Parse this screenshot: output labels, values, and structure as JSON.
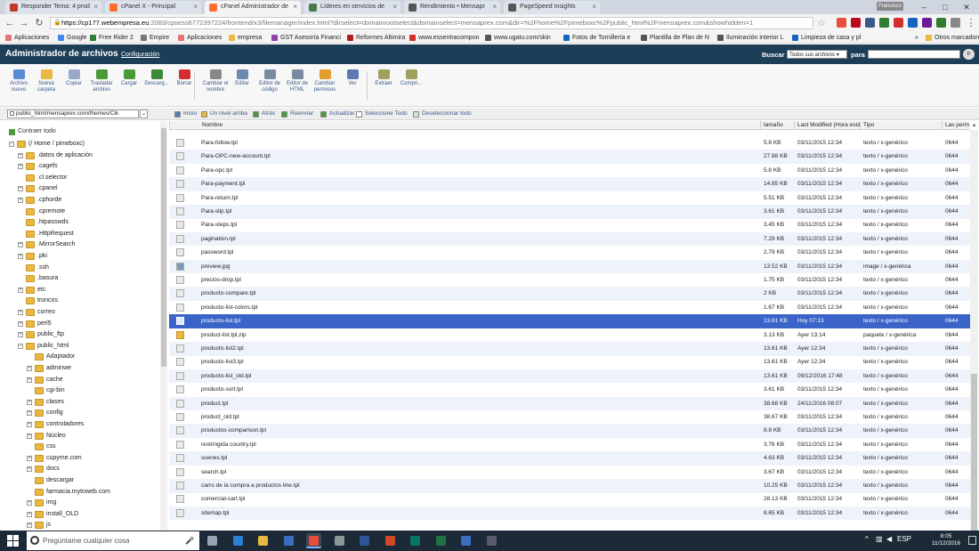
{
  "browser": {
    "tabs": [
      {
        "label": "Responder Tema: 4 prod",
        "icon": "forum-icon",
        "color": "#c0392b",
        "active": false
      },
      {
        "label": "cPanel X - Principal",
        "icon": "cpanel-icon",
        "color": "#ff6c2c",
        "active": false
      },
      {
        "label": "cPanel Administrador de",
        "icon": "cpanel-icon",
        "color": "#ff6c2c",
        "active": true
      },
      {
        "label": "Líderes en servicios de",
        "icon": "page-icon",
        "color": "#4a7a4a",
        "active": false
      },
      {
        "label": "Rendimiento • Mensapr",
        "icon": "page-icon",
        "color": "#555555",
        "active": false
      },
      {
        "label": "PageSpeed Insights",
        "icon": "page-icon",
        "color": "#555555",
        "active": false
      }
    ],
    "user": "Francisco",
    "url_host": "https://cp177.webempresa.eu",
    "url_path": ":2083/cpsess6772397224/frontend/x3/filemanager/index.html?dirselect=domainrootselect&domainselect=mensaprex.com&dir=%2Fhome%2Fpimeboxc%2Fpublic_html%2Fmensaprex.com&showhidden=1",
    "bookmarks": [
      {
        "label": "Aplicaciones",
        "color": "#e57373"
      },
      {
        "label": "Google",
        "color": "#4285f4"
      },
      {
        "label": "Free Rider 2",
        "color": "#2e7d32"
      },
      {
        "label": "Empire",
        "color": "#777777"
      },
      {
        "label": "Aplicaciones",
        "color": "#e57373"
      },
      {
        "label": "empresa",
        "color": "#e8b840"
      },
      {
        "label": "GST Asesoría Financi",
        "color": "#8e44ad"
      },
      {
        "label": "Reformes Altimira",
        "color": "#b71c1c"
      },
      {
        "label": "www.essentracompon",
        "color": "#d32f2f"
      },
      {
        "label": "www.ugatu.com/skin",
        "color": "#555555"
      },
      {
        "label": "Fotos de Tornillería e",
        "color": "#1565c0"
      },
      {
        "label": "Plantilla de Plan de N",
        "color": "#555555"
      },
      {
        "label": "Iluminación interior L",
        "color": "#555555"
      },
      {
        "label": "Limpieza de casa y pl",
        "color": "#1565c0"
      },
      {
        "label": "Otros marcadores",
        "color": "#e8b840"
      }
    ],
    "bookmarks_more": "»"
  },
  "cpanel": {
    "title": "Administrador de archivos",
    "config_link": "Configuración",
    "search_label": "Buscar",
    "search_scope": "Todos sus archivos",
    "search_for": "para",
    "search_query": "",
    "go_label": "Ir"
  },
  "toolbar": [
    {
      "label": "Archivo nuevo",
      "color": "#5a8ad0"
    },
    {
      "label": "Nueva carpeta",
      "color": "#e8b840"
    },
    {
      "label": "Copiar",
      "color": "#9aa9c8"
    },
    {
      "label": "Trasladar archivo",
      "color": "#4a9a3a"
    },
    {
      "label": "Cargar",
      "color": "#4a9a3a"
    },
    {
      "label": "Descarg...",
      "color": "#3a8a3a"
    },
    {
      "label": "Borrar",
      "color": "#d32f2f"
    },
    {
      "label": "Cambiar el nombre",
      "color": "#888888"
    },
    {
      "label": "Editar",
      "color": "#6a8ab0"
    },
    {
      "label": "Editor de código",
      "color": "#7a8aa0"
    },
    {
      "label": "Editor de HTML",
      "color": "#7a8aa0"
    },
    {
      "label": "Cambiar permisos",
      "color": "#e0a030"
    },
    {
      "label": "Ver",
      "color": "#5a7ab0"
    },
    {
      "label": "Extraer",
      "color": "#a0a060"
    },
    {
      "label": "Compri...",
      "color": "#a0a060"
    }
  ],
  "pathbar": {
    "path": "public_html/mensaprex.com/themes/Cik",
    "actions": [
      {
        "label": "Inicio",
        "color": "#5a7ab0"
      },
      {
        "label": "Un nivel arriba",
        "color": "#e8b840"
      },
      {
        "label": "Atrás",
        "color": "#4a9a3a"
      },
      {
        "label": "Reenviar",
        "color": "#4a9a3a"
      },
      {
        "label": "Actualizar",
        "color": "#4a9a3a"
      },
      {
        "label": "Seleccione Todo",
        "color": "#ffffff"
      },
      {
        "label": "Deseleccionar todo",
        "color": "#dddddd"
      }
    ]
  },
  "tree": {
    "collapse_label": "Contraer todo",
    "nodes": [
      {
        "label": "(/ Home / pimeboxc)",
        "depth": 0,
        "exp": "−"
      },
      {
        "label": ".datos de aplicación",
        "depth": 1,
        "exp": "+"
      },
      {
        "label": ".cagefs",
        "depth": 1,
        "exp": "+"
      },
      {
        "label": ".cl.selector",
        "depth": 1,
        "exp": ""
      },
      {
        "label": ".cpanel",
        "depth": 1,
        "exp": "+"
      },
      {
        "label": ".cphorde",
        "depth": 1,
        "exp": "+"
      },
      {
        "label": ".cpremote",
        "depth": 1,
        "exp": ""
      },
      {
        "label": ".htpasswds",
        "depth": 1,
        "exp": ""
      },
      {
        "label": ".HttpRequest",
        "depth": 1,
        "exp": ""
      },
      {
        "label": ".MirrorSearch",
        "depth": 1,
        "exp": "+"
      },
      {
        "label": ".pki",
        "depth": 1,
        "exp": "+"
      },
      {
        "label": ".ssh",
        "depth": 1,
        "exp": ""
      },
      {
        "label": ".basura",
        "depth": 1,
        "exp": ""
      },
      {
        "label": "etc",
        "depth": 1,
        "exp": "+"
      },
      {
        "label": "troncos",
        "depth": 1,
        "exp": ""
      },
      {
        "label": "correo",
        "depth": 1,
        "exp": "+"
      },
      {
        "label": "perl5",
        "depth": 1,
        "exp": "+"
      },
      {
        "label": "public_ftp",
        "depth": 1,
        "exp": "+"
      },
      {
        "label": "public_html",
        "depth": 1,
        "exp": "−"
      },
      {
        "label": "Adaptador",
        "depth": 2,
        "exp": ""
      },
      {
        "label": "adminwe",
        "depth": 2,
        "exp": "+"
      },
      {
        "label": "cache",
        "depth": 2,
        "exp": "+"
      },
      {
        "label": "cgi-bin",
        "depth": 2,
        "exp": ""
      },
      {
        "label": "clases",
        "depth": 2,
        "exp": "+"
      },
      {
        "label": "config",
        "depth": 2,
        "exp": "+"
      },
      {
        "label": "controladores",
        "depth": 2,
        "exp": "+"
      },
      {
        "label": "Núcleo",
        "depth": 2,
        "exp": "+"
      },
      {
        "label": "css",
        "depth": 2,
        "exp": ""
      },
      {
        "label": "cupyme.com",
        "depth": 2,
        "exp": "+"
      },
      {
        "label": "docs",
        "depth": 2,
        "exp": "+"
      },
      {
        "label": "descargar",
        "depth": 2,
        "exp": ""
      },
      {
        "label": "farmacia.mytoweb.com",
        "depth": 2,
        "exp": ""
      },
      {
        "label": "img",
        "depth": 2,
        "exp": "+"
      },
      {
        "label": "install_OLD",
        "depth": 2,
        "exp": "+"
      },
      {
        "label": "js",
        "depth": 2,
        "exp": "+"
      }
    ]
  },
  "files": {
    "columns": [
      "Nombre",
      "tamaño",
      "Last Modified (Hora está",
      "Tipo",
      "Las perm"
    ],
    "rows": [
      {
        "name": "Para-follow.tpl",
        "size": "5.8 KB",
        "modified": "03/11/2015 12:34",
        "type": "texto / x-genérico",
        "perms": "0644",
        "icon": "file"
      },
      {
        "name": "Para-OPC-new-account.tpl",
        "size": "27.88 KB",
        "modified": "03/11/2015 12:34",
        "type": "texto / x-genérico",
        "perms": "0644",
        "icon": "file"
      },
      {
        "name": "Para-opc.tpl",
        "size": "5.8 KB",
        "modified": "03/11/2015 12:34",
        "type": "texto / x-genérico",
        "perms": "0644",
        "icon": "file"
      },
      {
        "name": "Para-payment.tpl",
        "size": "14.85 KB",
        "modified": "03/11/2015 12:34",
        "type": "texto / x-genérico",
        "perms": "0644",
        "icon": "file"
      },
      {
        "name": "Para-return.tpl",
        "size": "5.51 KB",
        "modified": "03/11/2015 12:34",
        "type": "texto / x-genérico",
        "perms": "0644",
        "icon": "file"
      },
      {
        "name": "Para-slip.tpl",
        "size": "3.61 KB",
        "modified": "03/11/2015 12:34",
        "type": "texto / x-genérico",
        "perms": "0644",
        "icon": "file"
      },
      {
        "name": "Para-steps.tpl",
        "size": "3.45 KB",
        "modified": "03/11/2015 12:34",
        "type": "texto / x-genérico",
        "perms": "0644",
        "icon": "file"
      },
      {
        "name": "pagination.tpl",
        "size": "7.29 KB",
        "modified": "03/11/2015 12:34",
        "type": "texto / x-genérico",
        "perms": "0644",
        "icon": "file"
      },
      {
        "name": "password.tpl",
        "size": "2.79 KB",
        "modified": "03/11/2015 12:34",
        "type": "texto / x-genérico",
        "perms": "0644",
        "icon": "file"
      },
      {
        "name": "preview.jpg",
        "size": "13.52 KB",
        "modified": "03/11/2015 12:34",
        "type": "image / x-genérica",
        "perms": "0644",
        "icon": "img"
      },
      {
        "name": "precios-drop.tpl",
        "size": "1.75 KB",
        "modified": "03/11/2015 12:34",
        "type": "texto / x-genérico",
        "perms": "0644",
        "icon": "file"
      },
      {
        "name": "producto-compare.tpl",
        "size": "2 KB",
        "modified": "03/11/2015 12:34",
        "type": "texto / x-genérico",
        "perms": "0644",
        "icon": "file"
      },
      {
        "name": "producto-list-colors.tpl",
        "size": "1.67 KB",
        "modified": "03/11/2015 12:34",
        "type": "texto / x-genérico",
        "perms": "0644",
        "icon": "file"
      },
      {
        "name": "producto-list.tpl",
        "size": "13.61 KB",
        "modified": "Hoy 07:13",
        "type": "texto / x-genérico",
        "perms": "0644",
        "icon": "file",
        "selected": true
      },
      {
        "name": "product-list.tpl.zip",
        "size": "3.13 KB",
        "modified": "Ayer 13:14",
        "type": "paquete / x-genérica",
        "perms": "0644",
        "icon": "zip"
      },
      {
        "name": "producto-list2.tpl",
        "size": "13.61 KB",
        "modified": "Ayer 12:34",
        "type": "texto / x-genérico",
        "perms": "0644",
        "icon": "file"
      },
      {
        "name": "producto-list3.tpl",
        "size": "13.61 KB",
        "modified": "Ayer 12:34",
        "type": "texto / x-genérico",
        "perms": "0644",
        "icon": "file"
      },
      {
        "name": "producto-list_old.tpl",
        "size": "13.61 KB",
        "modified": "09/12/2016 17:48",
        "type": "texto / x-genérico",
        "perms": "0644",
        "icon": "file"
      },
      {
        "name": "producto-sort.tpl",
        "size": "3.61 KB",
        "modified": "03/11/2015 12:34",
        "type": "texto / x-genérico",
        "perms": "0644",
        "icon": "file"
      },
      {
        "name": "product.tpl",
        "size": "38.68 KB",
        "modified": "24/11/2016 08:07",
        "type": "texto / x-genérico",
        "perms": "0644",
        "icon": "file"
      },
      {
        "name": "product_old.tpl",
        "size": "38.67 KB",
        "modified": "03/11/2015 12:34",
        "type": "texto / x-genérico",
        "perms": "0644",
        "icon": "file"
      },
      {
        "name": "productos-comparison.tpl",
        "size": "8.8 KB",
        "modified": "03/11/2015 12:34",
        "type": "texto / x-genérico",
        "perms": "0644",
        "icon": "file"
      },
      {
        "name": "restringida country.tpl",
        "size": "3.76 KB",
        "modified": "03/11/2015 12:34",
        "type": "texto / x-genérico",
        "perms": "0644",
        "icon": "file"
      },
      {
        "name": "scenes.tpl",
        "size": "4.63 KB",
        "modified": "03/11/2015 12:34",
        "type": "texto / x-genérico",
        "perms": "0644",
        "icon": "file"
      },
      {
        "name": "search.tpl",
        "size": "3.67 KB",
        "modified": "03/11/2015 12:34",
        "type": "texto / x-genérico",
        "perms": "0644",
        "icon": "file"
      },
      {
        "name": "carro de la compra a productos line.tpl",
        "size": "10.25 KB",
        "modified": "03/11/2015 12:34",
        "type": "texto / x-genérico",
        "perms": "0644",
        "icon": "file"
      },
      {
        "name": "comercial-cart.tpl",
        "size": "28.13 KB",
        "modified": "03/11/2015 12:34",
        "type": "texto / x-genérico",
        "perms": "0644",
        "icon": "file"
      },
      {
        "name": "sitemap.tpl",
        "size": "8.65 KB",
        "modified": "03/11/2015 12:34",
        "type": "texto / x-genérico",
        "perms": "0644",
        "icon": "file"
      }
    ]
  },
  "taskbar": {
    "search_placeholder": "Pregúntame cualquier cosa",
    "apps": [
      {
        "name": "task-view",
        "color": "#9aa4b0"
      },
      {
        "name": "edge",
        "color": "#2d7fd3"
      },
      {
        "name": "file-explorer",
        "color": "#e8b840"
      },
      {
        "name": "store",
        "color": "#3a6fc0"
      },
      {
        "name": "chrome",
        "color": "#e74c3c",
        "active": true
      },
      {
        "name": "app-gray",
        "color": "#8a9a9a"
      },
      {
        "name": "word",
        "color": "#2b579a"
      },
      {
        "name": "powerpoint",
        "color": "#d24726"
      },
      {
        "name": "publisher",
        "color": "#077568"
      },
      {
        "name": "excel",
        "color": "#217346"
      },
      {
        "name": "photos",
        "color": "#3a6fc0"
      },
      {
        "name": "calculator",
        "color": "#5a5a6a"
      }
    ],
    "lang": "ESP",
    "time": "8:05",
    "date": "11/12/2016"
  }
}
